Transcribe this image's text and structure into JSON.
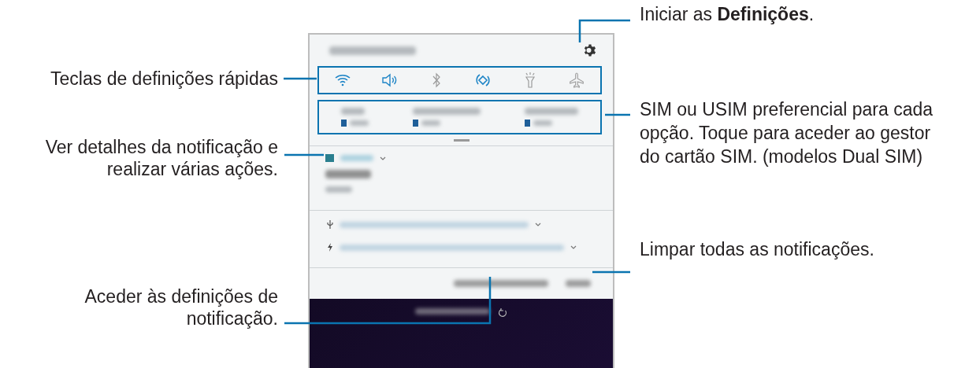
{
  "callouts_left": [
    {
      "text": "Teclas de definições rápidas"
    },
    {
      "text": "Ver detalhes da notificação e realizar várias ações."
    },
    {
      "text": "Aceder às definições de notificação."
    }
  ],
  "callouts_right": [
    {
      "text": "Iniciar as **Definições**."
    },
    {
      "text": "SIM ou USIM preferencial para cada opção. Toque para aceder ao gestor do cartão SIM. (modelos Dual SIM)"
    },
    {
      "text": "Limpar todas as notificações."
    }
  ],
  "quick_settings": [
    {
      "kind": "wifi",
      "on": true
    },
    {
      "kind": "sound",
      "on": true
    },
    {
      "kind": "bluetooth",
      "on": false
    },
    {
      "kind": "rotation",
      "on": true
    },
    {
      "kind": "flashlight",
      "on": false
    },
    {
      "kind": "airplane",
      "on": false
    }
  ]
}
